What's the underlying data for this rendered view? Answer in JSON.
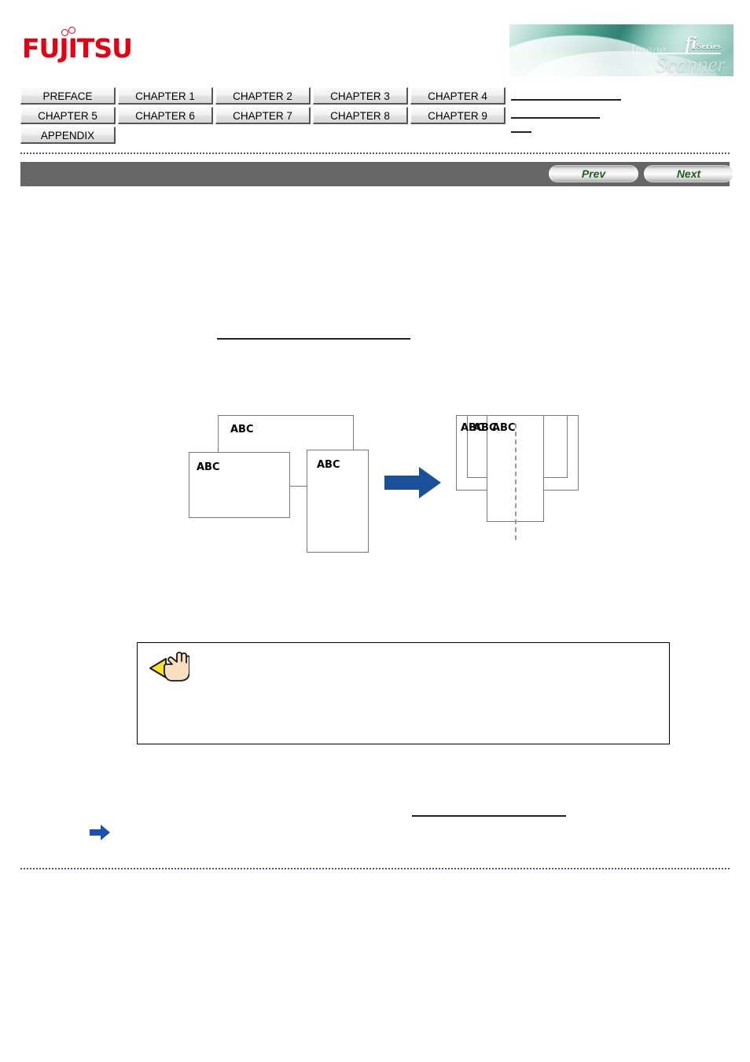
{
  "header": {
    "brand": "FUJITSU",
    "banner": {
      "fi": "fi",
      "series": "Series",
      "image_word": "Image",
      "scanner_word": "Scanner"
    }
  },
  "tab_nav": {
    "rows": [
      [
        {
          "label": "PREFACE",
          "name": "tab-preface"
        },
        {
          "label": "CHAPTER 1",
          "name": "tab-chapter-1"
        },
        {
          "label": "CHAPTER 2",
          "name": "tab-chapter-2"
        },
        {
          "label": "CHAPTER 3",
          "name": "tab-chapter-3"
        },
        {
          "label": "CHAPTER 4",
          "name": "tab-chapter-4"
        }
      ],
      [
        {
          "label": "CHAPTER 5",
          "name": "tab-chapter-5"
        },
        {
          "label": "CHAPTER 6",
          "name": "tab-chapter-6"
        },
        {
          "label": "CHAPTER 7",
          "name": "tab-chapter-7"
        },
        {
          "label": "CHAPTER 8",
          "name": "tab-chapter-8"
        },
        {
          "label": "CHAPTER 9",
          "name": "tab-chapter-9"
        }
      ],
      [
        {
          "label": "APPENDIX",
          "name": "tab-appendix"
        }
      ]
    ]
  },
  "toolbar": {
    "prev_label": "Prev",
    "next_label": "Next",
    "background_color": "#666666",
    "button_text_color": "#1f5c1f"
  },
  "content": {
    "intro_text": "",
    "section_text": "",
    "after_text": "",
    "note_text": "",
    "bullet_text": ""
  },
  "diagram": {
    "documents_left": [
      {
        "label": "ABC",
        "name": "doc-unaligned-top"
      },
      {
        "label": "ABC",
        "name": "doc-unaligned-left"
      },
      {
        "label": "ABC",
        "name": "doc-unaligned-right"
      }
    ],
    "documents_right": [
      {
        "label": "ABC",
        "name": "doc-aligned-back"
      },
      {
        "label": "ABC",
        "name": "doc-aligned-middle"
      },
      {
        "label": "ABC",
        "name": "doc-aligned-front"
      }
    ],
    "arrow_color": "#1a4f9c",
    "document_border_color": "#7a7a7a",
    "center_line_color": "#9a9a9a"
  },
  "colors": {
    "brand_red": "#e60012",
    "toolbar_gray": "#666666",
    "dotted_separator": "#4a5a78",
    "bullet_arrow_blue": "#1a4fb4",
    "hint_triangle_yellow": "#f5e12a"
  },
  "icons": {
    "hint": "hand-hint-icon",
    "bullet": "blue-right-arrow-icon",
    "flow": "blue-flow-arrow-icon"
  }
}
